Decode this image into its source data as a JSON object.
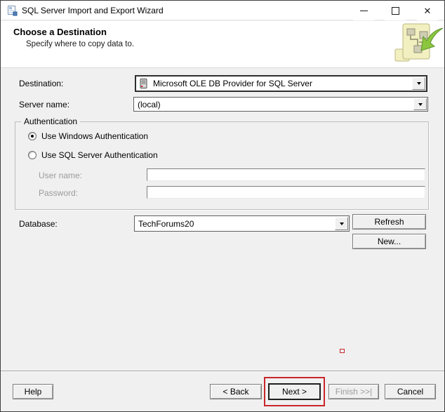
{
  "window": {
    "title": "SQL Server Import and Export Wizard",
    "controls": {
      "minimize": "minimize",
      "maximize": "maximize",
      "close": "✕"
    }
  },
  "header": {
    "title": "Choose a Destination",
    "subtitle": "Specify where to copy data to."
  },
  "form": {
    "destination": {
      "label": "Destination:",
      "value": "Microsoft OLE DB Provider for SQL Server"
    },
    "server": {
      "label": "Server name:",
      "value": "(local)"
    },
    "auth": {
      "legend": "Authentication",
      "windows_label": "Use Windows Authentication",
      "sql_label": "Use SQL Server Authentication",
      "selected": "windows",
      "username_label": "User name:",
      "username_value": "",
      "password_label": "Password:",
      "password_value": ""
    },
    "database": {
      "label": "Database:",
      "value": "TechForums20"
    },
    "buttons": {
      "refresh": "Refresh",
      "new": "New..."
    }
  },
  "footer": {
    "help": "Help",
    "back": "< Back",
    "next": "Next >",
    "finish": "Finish >>|",
    "cancel": "Cancel",
    "finish_disabled": true
  },
  "icons": {
    "app": "wizard-app-icon",
    "header": "import-export-diagram-icon",
    "provider": "database-server-icon",
    "dropdown": "dropdown-arrow-icon"
  },
  "colors": {
    "annotation_red": "#c9262c",
    "dialog_bg": "#f0f0f0",
    "titlebar_bg": "#ffffff",
    "icon_yellow": "#f2efc0",
    "icon_green": "#8cc63e"
  }
}
